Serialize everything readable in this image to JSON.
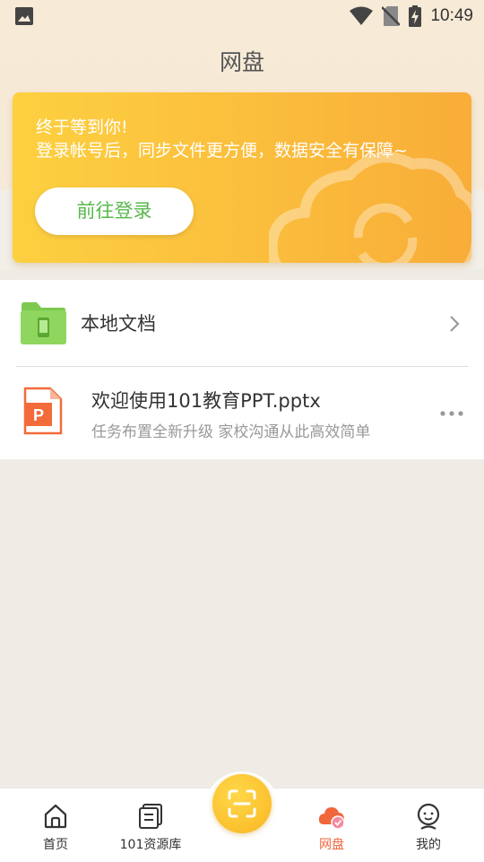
{
  "status_bar": {
    "time": "10:49"
  },
  "header": {
    "title": "网盘"
  },
  "banner": {
    "line1": "终于等到你!",
    "line2": "登录帐号后，同步文件更方便，数据安全有保障~",
    "login_button": "前往登录"
  },
  "list": {
    "local_docs_label": "本地文档",
    "files": [
      {
        "name": "欢迎使用101教育PPT.pptx",
        "description": "任务布置全新升级 家校沟通从此高效简单",
        "icon": "ppt-file-icon"
      }
    ]
  },
  "bottom_nav": {
    "items": [
      {
        "label": "首页",
        "icon": "home-icon",
        "active": false
      },
      {
        "label": "101资源库",
        "icon": "resource-library-icon",
        "active": false
      },
      {
        "label": "网盘",
        "icon": "cloud-disk-icon",
        "active": true
      },
      {
        "label": "我的",
        "icon": "profile-icon",
        "active": false
      }
    ],
    "center_button_icon": "scan-icon"
  },
  "colors": {
    "accent_green": "#59b84d",
    "banner_yellow": "#fbbf3d",
    "active_tab": "#f2663c",
    "ppt_red": "#f26b3a"
  }
}
